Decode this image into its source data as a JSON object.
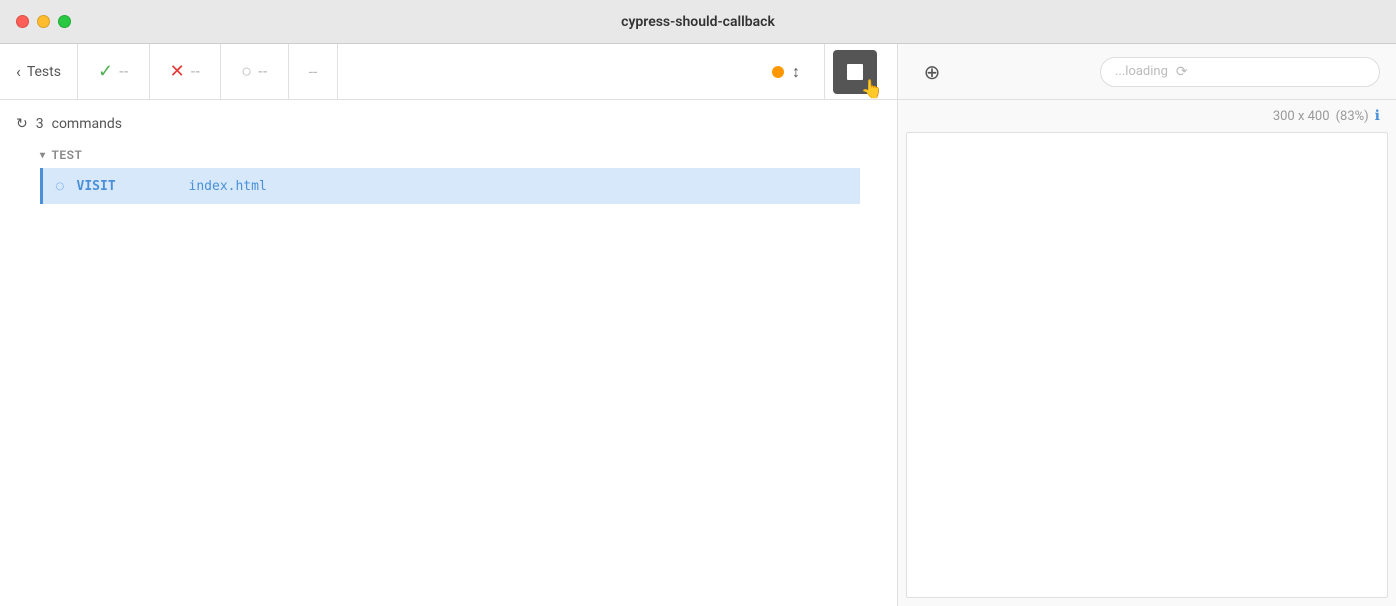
{
  "titleBar": {
    "title": "cypress-should-callback",
    "trafficLights": [
      "red",
      "yellow",
      "green"
    ]
  },
  "toolbar": {
    "back_label": "Tests",
    "pass_count": "--",
    "fail_count": "--",
    "pending_count": "--",
    "dash_only": "--",
    "stop_label": "Stop",
    "crosshair_label": "Crosshair"
  },
  "commands_header": {
    "count": "3",
    "label": "commands"
  },
  "test": {
    "group_label": "TEST",
    "command": {
      "name": "VISIT",
      "argument": "index.html"
    }
  },
  "rightPanel": {
    "dimensions": "300 x 400",
    "zoom": "(83%)",
    "search_placeholder": "...loading"
  }
}
